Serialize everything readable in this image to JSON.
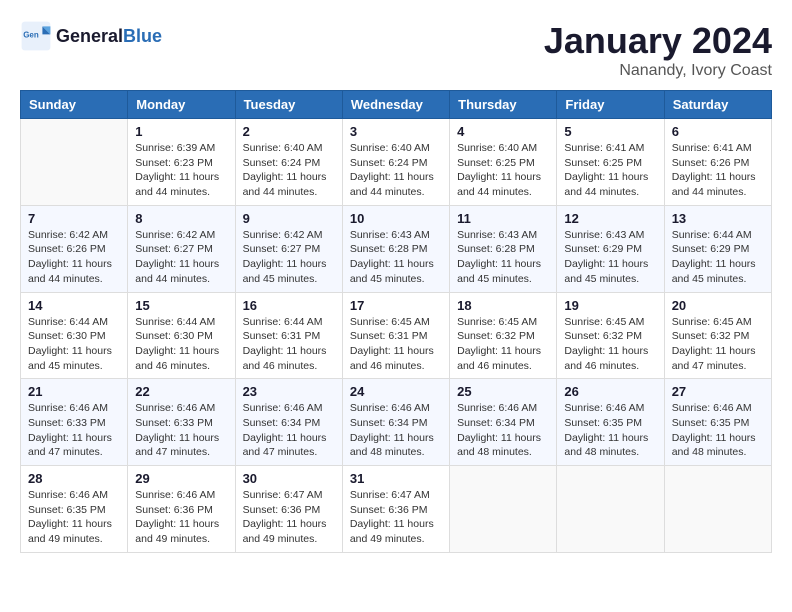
{
  "header": {
    "logo_text_general": "General",
    "logo_text_blue": "Blue",
    "month_year": "January 2024",
    "location": "Nanandy, Ivory Coast"
  },
  "weekdays": [
    "Sunday",
    "Monday",
    "Tuesday",
    "Wednesday",
    "Thursday",
    "Friday",
    "Saturday"
  ],
  "weeks": [
    [
      {
        "day": "",
        "sunrise": "",
        "sunset": "",
        "daylight": ""
      },
      {
        "day": "1",
        "sunrise": "Sunrise: 6:39 AM",
        "sunset": "Sunset: 6:23 PM",
        "daylight": "Daylight: 11 hours and 44 minutes."
      },
      {
        "day": "2",
        "sunrise": "Sunrise: 6:40 AM",
        "sunset": "Sunset: 6:24 PM",
        "daylight": "Daylight: 11 hours and 44 minutes."
      },
      {
        "day": "3",
        "sunrise": "Sunrise: 6:40 AM",
        "sunset": "Sunset: 6:24 PM",
        "daylight": "Daylight: 11 hours and 44 minutes."
      },
      {
        "day": "4",
        "sunrise": "Sunrise: 6:40 AM",
        "sunset": "Sunset: 6:25 PM",
        "daylight": "Daylight: 11 hours and 44 minutes."
      },
      {
        "day": "5",
        "sunrise": "Sunrise: 6:41 AM",
        "sunset": "Sunset: 6:25 PM",
        "daylight": "Daylight: 11 hours and 44 minutes."
      },
      {
        "day": "6",
        "sunrise": "Sunrise: 6:41 AM",
        "sunset": "Sunset: 6:26 PM",
        "daylight": "Daylight: 11 hours and 44 minutes."
      }
    ],
    [
      {
        "day": "7",
        "sunrise": "Sunrise: 6:42 AM",
        "sunset": "Sunset: 6:26 PM",
        "daylight": "Daylight: 11 hours and 44 minutes."
      },
      {
        "day": "8",
        "sunrise": "Sunrise: 6:42 AM",
        "sunset": "Sunset: 6:27 PM",
        "daylight": "Daylight: 11 hours and 44 minutes."
      },
      {
        "day": "9",
        "sunrise": "Sunrise: 6:42 AM",
        "sunset": "Sunset: 6:27 PM",
        "daylight": "Daylight: 11 hours and 45 minutes."
      },
      {
        "day": "10",
        "sunrise": "Sunrise: 6:43 AM",
        "sunset": "Sunset: 6:28 PM",
        "daylight": "Daylight: 11 hours and 45 minutes."
      },
      {
        "day": "11",
        "sunrise": "Sunrise: 6:43 AM",
        "sunset": "Sunset: 6:28 PM",
        "daylight": "Daylight: 11 hours and 45 minutes."
      },
      {
        "day": "12",
        "sunrise": "Sunrise: 6:43 AM",
        "sunset": "Sunset: 6:29 PM",
        "daylight": "Daylight: 11 hours and 45 minutes."
      },
      {
        "day": "13",
        "sunrise": "Sunrise: 6:44 AM",
        "sunset": "Sunset: 6:29 PM",
        "daylight": "Daylight: 11 hours and 45 minutes."
      }
    ],
    [
      {
        "day": "14",
        "sunrise": "Sunrise: 6:44 AM",
        "sunset": "Sunset: 6:30 PM",
        "daylight": "Daylight: 11 hours and 45 minutes."
      },
      {
        "day": "15",
        "sunrise": "Sunrise: 6:44 AM",
        "sunset": "Sunset: 6:30 PM",
        "daylight": "Daylight: 11 hours and 46 minutes."
      },
      {
        "day": "16",
        "sunrise": "Sunrise: 6:44 AM",
        "sunset": "Sunset: 6:31 PM",
        "daylight": "Daylight: 11 hours and 46 minutes."
      },
      {
        "day": "17",
        "sunrise": "Sunrise: 6:45 AM",
        "sunset": "Sunset: 6:31 PM",
        "daylight": "Daylight: 11 hours and 46 minutes."
      },
      {
        "day": "18",
        "sunrise": "Sunrise: 6:45 AM",
        "sunset": "Sunset: 6:32 PM",
        "daylight": "Daylight: 11 hours and 46 minutes."
      },
      {
        "day": "19",
        "sunrise": "Sunrise: 6:45 AM",
        "sunset": "Sunset: 6:32 PM",
        "daylight": "Daylight: 11 hours and 46 minutes."
      },
      {
        "day": "20",
        "sunrise": "Sunrise: 6:45 AM",
        "sunset": "Sunset: 6:32 PM",
        "daylight": "Daylight: 11 hours and 47 minutes."
      }
    ],
    [
      {
        "day": "21",
        "sunrise": "Sunrise: 6:46 AM",
        "sunset": "Sunset: 6:33 PM",
        "daylight": "Daylight: 11 hours and 47 minutes."
      },
      {
        "day": "22",
        "sunrise": "Sunrise: 6:46 AM",
        "sunset": "Sunset: 6:33 PM",
        "daylight": "Daylight: 11 hours and 47 minutes."
      },
      {
        "day": "23",
        "sunrise": "Sunrise: 6:46 AM",
        "sunset": "Sunset: 6:34 PM",
        "daylight": "Daylight: 11 hours and 47 minutes."
      },
      {
        "day": "24",
        "sunrise": "Sunrise: 6:46 AM",
        "sunset": "Sunset: 6:34 PM",
        "daylight": "Daylight: 11 hours and 48 minutes."
      },
      {
        "day": "25",
        "sunrise": "Sunrise: 6:46 AM",
        "sunset": "Sunset: 6:34 PM",
        "daylight": "Daylight: 11 hours and 48 minutes."
      },
      {
        "day": "26",
        "sunrise": "Sunrise: 6:46 AM",
        "sunset": "Sunset: 6:35 PM",
        "daylight": "Daylight: 11 hours and 48 minutes."
      },
      {
        "day": "27",
        "sunrise": "Sunrise: 6:46 AM",
        "sunset": "Sunset: 6:35 PM",
        "daylight": "Daylight: 11 hours and 48 minutes."
      }
    ],
    [
      {
        "day": "28",
        "sunrise": "Sunrise: 6:46 AM",
        "sunset": "Sunset: 6:35 PM",
        "daylight": "Daylight: 11 hours and 49 minutes."
      },
      {
        "day": "29",
        "sunrise": "Sunrise: 6:46 AM",
        "sunset": "Sunset: 6:36 PM",
        "daylight": "Daylight: 11 hours and 49 minutes."
      },
      {
        "day": "30",
        "sunrise": "Sunrise: 6:47 AM",
        "sunset": "Sunset: 6:36 PM",
        "daylight": "Daylight: 11 hours and 49 minutes."
      },
      {
        "day": "31",
        "sunrise": "Sunrise: 6:47 AM",
        "sunset": "Sunset: 6:36 PM",
        "daylight": "Daylight: 11 hours and 49 minutes."
      },
      {
        "day": "",
        "sunrise": "",
        "sunset": "",
        "daylight": ""
      },
      {
        "day": "",
        "sunrise": "",
        "sunset": "",
        "daylight": ""
      },
      {
        "day": "",
        "sunrise": "",
        "sunset": "",
        "daylight": ""
      }
    ]
  ]
}
